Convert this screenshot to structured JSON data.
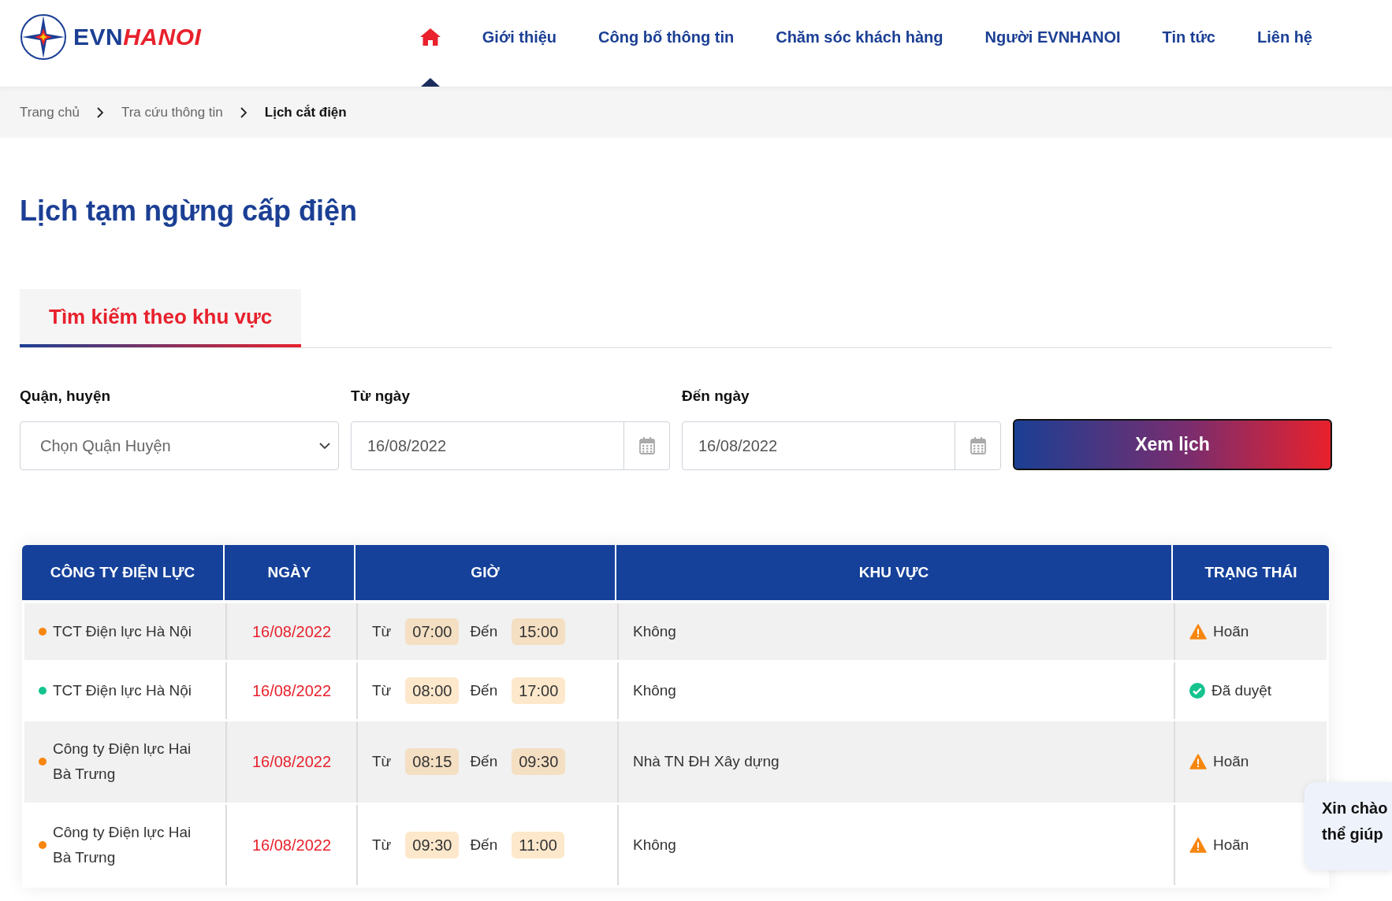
{
  "header": {
    "logo": {
      "part1": "EVN",
      "part2": "HANOI"
    },
    "nav": [
      {
        "kind": "home",
        "selected": true
      },
      {
        "kind": "link",
        "label": "Giới thiệu",
        "selected": false
      },
      {
        "kind": "link",
        "label": "Công bố thông tin",
        "selected": false
      },
      {
        "kind": "link",
        "label": "Chăm sóc khách hàng",
        "selected": false
      },
      {
        "kind": "link",
        "label": "Người EVNHANOI",
        "selected": false
      },
      {
        "kind": "link",
        "label": "Tin tức",
        "selected": false
      },
      {
        "kind": "link",
        "label": "Liên hệ",
        "selected": false
      }
    ]
  },
  "breadcrumb": [
    "Trang chủ",
    "Tra cứu thông tin",
    "Lịch cắt điện"
  ],
  "title": "Lịch tạm ngừng cấp điện",
  "tabs": [
    {
      "label": "Tìm kiếm theo khu vực",
      "selected": true
    }
  ],
  "filters": {
    "district": {
      "label": "Quận, huyện",
      "placeholder": "Chọn Quận Huyện"
    },
    "from": {
      "label": "Từ ngày",
      "value": "16/08/2022"
    },
    "to": {
      "label": "Đến ngày",
      "value": "16/08/2022"
    },
    "button": "Xem lịch"
  },
  "table": {
    "columns": [
      "CÔNG TY ĐIỆN LỰC",
      "NGÀY",
      "GIỜ",
      "KHU VỰC",
      "TRẠNG THÁI"
    ],
    "rows": [
      {
        "company": "TCT Điện lực Hà Nội",
        "color": "#f7860f",
        "date": "16/08/2022",
        "from_label": "Từ",
        "from": "07:00",
        "to_label": "Đến",
        "to": "15:00",
        "area": "Không",
        "kind": "postponed",
        "status": "Hoãn"
      },
      {
        "company": "TCT Điện lực Hà Nội",
        "color": "#14c38e",
        "date": "16/08/2022",
        "from_label": "Từ",
        "from": "08:00",
        "to_label": "Đến",
        "to": "17:00",
        "area": "Không",
        "kind": "approved",
        "status": "Đã duyệt"
      },
      {
        "company": "Công ty Điện lực Hai Bà Trưng",
        "color": "#f7860f",
        "date": "16/08/2022",
        "from_label": "Từ",
        "from": "08:15",
        "to_label": "Đến",
        "to": "09:30",
        "area": "Nhà TN ĐH Xây dựng",
        "kind": "postponed",
        "status": "Hoãn"
      },
      {
        "company": "Công ty Điện lực Hai Bà Trưng",
        "color": "#f7860f",
        "date": "16/08/2022",
        "from_label": "Từ",
        "from": "09:30",
        "to_label": "Đến",
        "to": "11:00",
        "area": "Không",
        "kind": "postponed",
        "status": "Hoãn"
      }
    ]
  },
  "chat_bubble": {
    "lines": [
      "Xin chào",
      "thể giúp"
    ]
  }
}
